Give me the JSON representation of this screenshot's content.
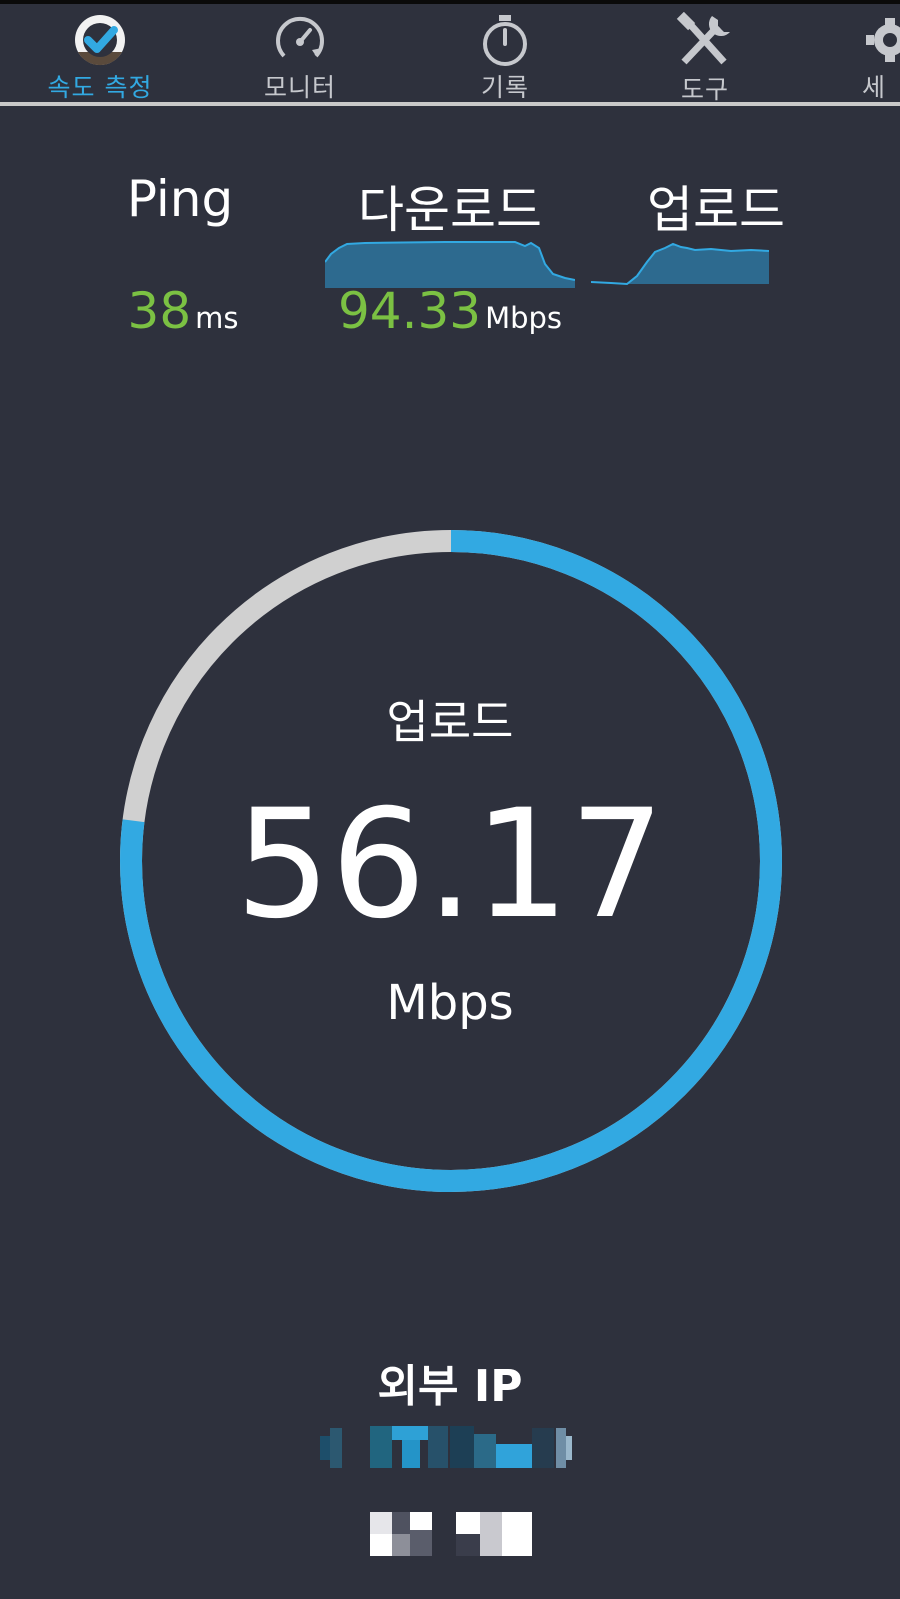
{
  "tabs": [
    {
      "label": "속도 측정",
      "icon": "check-gauge-icon",
      "active": true
    },
    {
      "label": "모니터",
      "icon": "speedometer-icon",
      "active": false
    },
    {
      "label": "기록",
      "icon": "stopwatch-icon",
      "active": false
    },
    {
      "label": "도구",
      "icon": "tools-icon",
      "active": false
    },
    {
      "label": "세",
      "icon": "gear-icon",
      "active": false
    }
  ],
  "results": {
    "ping": {
      "label": "Ping",
      "value": "38",
      "unit": "ms"
    },
    "download": {
      "label": "다운로드",
      "value": "94.33",
      "unit": "Mbps"
    },
    "upload": {
      "label": "업로드"
    }
  },
  "gauge": {
    "title": "업로드",
    "value": "56.17",
    "unit": "Mbps",
    "progress": 0.77
  },
  "external_ip": {
    "label": "외부 IP"
  },
  "colors": {
    "background": "#2e313d",
    "accent": "#32a9e2",
    "value_green": "#7bc143",
    "track": "#d0d0d0"
  }
}
